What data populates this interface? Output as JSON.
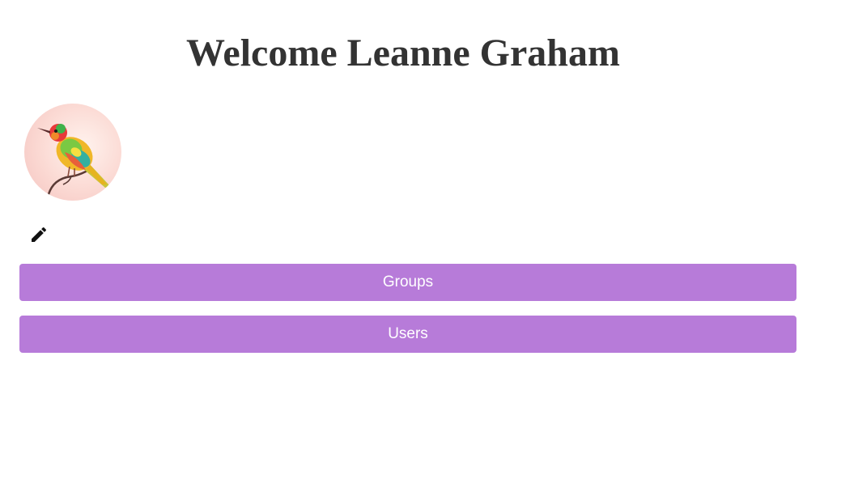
{
  "header": {
    "title": "Welcome Leanne Graham"
  },
  "profile": {
    "avatar_icon": "bird-avatar-image",
    "edit_icon": "pencil-icon"
  },
  "actions": {
    "groups_label": "Groups",
    "users_label": "Users",
    "button_color": "#b77bd9",
    "button_text_color": "#ffffff"
  }
}
